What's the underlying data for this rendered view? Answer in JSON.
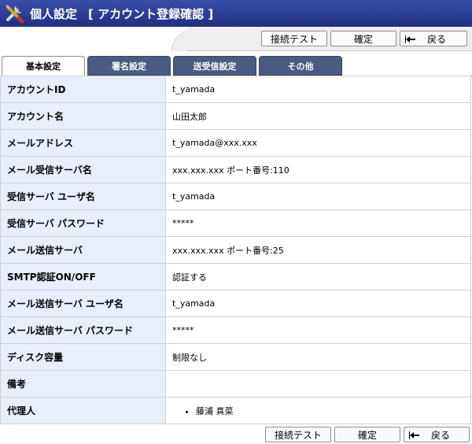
{
  "header": {
    "title": "個人設定",
    "subtitle": "[ アカウント登録確認 ]",
    "icon": "tools-icon",
    "background": "#2a3b92"
  },
  "toolbar": {
    "test_label": "接続テスト",
    "confirm_label": "確定",
    "back_label": "戻る"
  },
  "tabs": [
    {
      "label": "基本設定",
      "active": true
    },
    {
      "label": "署名設定",
      "active": false
    },
    {
      "label": "送受信設定",
      "active": false
    },
    {
      "label": "その他",
      "active": false
    }
  ],
  "rows": [
    {
      "label": "アカウントID",
      "value": "t_yamada"
    },
    {
      "label": "アカウント名",
      "value": "山田太郎"
    },
    {
      "label": "メールアドレス",
      "value": "t_yamada@xxx.xxx"
    },
    {
      "label": "メール受信サーバ名",
      "value": "xxx.xxx.xxx ポート番号:110"
    },
    {
      "label": "受信サーバ ユーザ名",
      "value": "t_yamada"
    },
    {
      "label": "受信サーバ パスワード",
      "value": "*****"
    },
    {
      "label": "メール送信サーバ",
      "value": "xxx.xxx.xxx ポート番号:25"
    },
    {
      "label": "SMTP認証ON/OFF",
      "value": "認証する"
    },
    {
      "label": "メール送信サーバ ユーザ名",
      "value": "t_yamada"
    },
    {
      "label": "メール送信サーバ パスワード",
      "value": "*****"
    },
    {
      "label": "ディスク容量",
      "value": "制限なし"
    },
    {
      "label": "備考",
      "value": ""
    },
    {
      "label": "代理人",
      "items": [
        "藤浦 真菜"
      ]
    }
  ],
  "colors": {
    "label_bg": "#e8eefa",
    "tab_inactive": "#4b5a80"
  }
}
